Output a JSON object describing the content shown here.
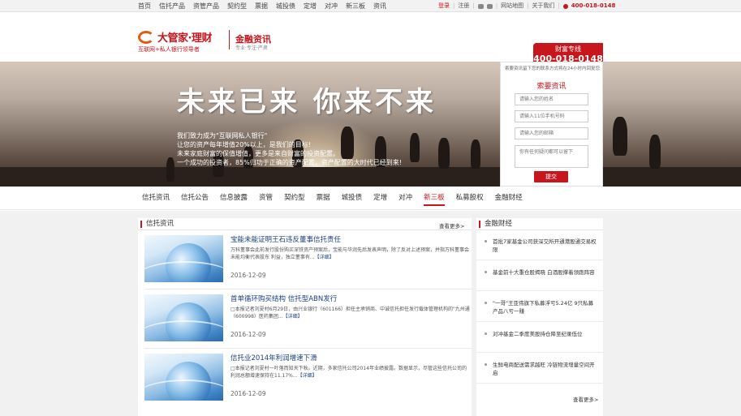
{
  "topnav": {
    "items": [
      "首页",
      "信托产品",
      "资管产品",
      "契约型",
      "票据",
      "城投债",
      "定增",
      "对冲",
      "新三板",
      "资讯"
    ]
  },
  "topbar_right": {
    "login": "登录",
    "register": "注册",
    "sitemap": "网站地图",
    "about": "关于我们",
    "phone": "400-018-0148"
  },
  "header": {
    "logo_main": "大管家·理财",
    "logo_sub": "互联网+私人银行领导者",
    "slogan_main": "金融资讯",
    "slogan_sub": "专业·专注·严肃",
    "hotline_label": "财富专线",
    "hotline_number": "400-018-0148"
  },
  "banner": {
    "title": "未来已来 你来不来",
    "lines": [
      "我们致力成为\"互联网私人银行\"",
      "让您的资产每年增值20%以上，是我们的目标!",
      "未来家庭财富的保值增值，更多是来自财富的投资配置。",
      "一个成功的投资者，85%归功于正确的资产配置，资产配置的大时代已经到来!"
    ]
  },
  "consult_form": {
    "note": "索要资讯留下您的联系方式将在24小时内回复您",
    "title": "索要资讯",
    "name_placeholder": "请输入您的姓名",
    "phone_placeholder": "请输入11位手机号码",
    "email_placeholder": "请输入您的邮箱",
    "question_placeholder": "你有任何疑问都可以留下",
    "submit": "提交"
  },
  "subnav": {
    "items": [
      "信托资讯",
      "信托公告",
      "信息披露",
      "资管",
      "契约型",
      "票据",
      "城投债",
      "定增",
      "对冲",
      "新三板",
      "私募股权",
      "金融财经"
    ],
    "active": "新三板"
  },
  "news_panel": {
    "title": "信托资讯",
    "more": "查看更多>",
    "items": [
      {
        "title": "宝能未能证明王石违反董事信托责任",
        "summary": "万科董事会此前发行股份购买深铁资产预案后，宝能与华润先后发表声明，除了反对上述预案，并指万科董事会未能均衡代表股东 利益，独立董事有...",
        "detail": "【详细】",
        "date": "2016-12-09"
      },
      {
        "title": "首单循环购买结构 信托型ABN发行",
        "summary": "□本报记者刘夏村6月29日，由兴业银行（601166）担任主承销商、中诚信托担任发行载体管理机构的\"九州通（600998）医药集团...",
        "detail": "【详细】",
        "date": "2016-12-09"
      },
      {
        "title": "信托业2014年利润增速下滑",
        "summary": "□本报记者刘夏村一叶落而知天下秋。近期，多家信托公司2014年业绩披露。数据显示，尽管这些信托公司的利润总额增速保持在11.17%...",
        "detail": "【详细】",
        "date": "2016-12-09"
      }
    ]
  },
  "finance_panel": {
    "title": "金融财经",
    "more": "查看更多>",
    "items": [
      "首批7家基金公司获深交所开通港股通交易权限",
      "基金前十大重仓股揭晓 白酒股撑着领跑阵容",
      "\"一哥\"王亚伟旗下私募浮亏5.24亿 9只私募产品八亏一赚",
      "对冲基金二季度美股持仓降至纪录低位",
      "生鲜电商配送需求越旺 冷链物流增量空间开启"
    ]
  }
}
